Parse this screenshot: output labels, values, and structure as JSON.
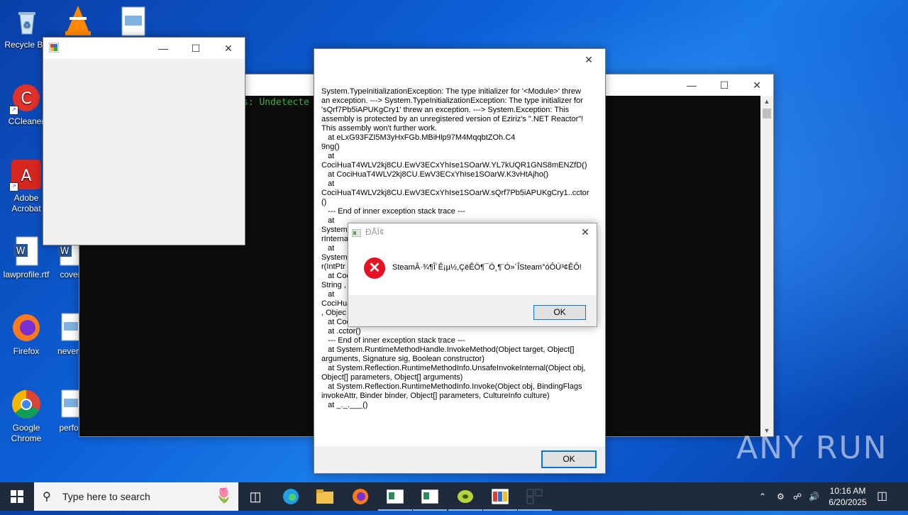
{
  "desktop": {
    "icons": [
      {
        "label": "Recycle Bin"
      },
      {
        "label": "CCleaner"
      },
      {
        "label": "Adobe Acrobat"
      },
      {
        "label": "lawprofile.rtf"
      },
      {
        "label": "Firefox"
      },
      {
        "label": "Google Chrome"
      },
      {
        "label": "cover"
      },
      {
        "label": "neverc"
      },
      {
        "label": "perfor"
      }
    ]
  },
  "console": {
    "text": "s: Undetecte"
  },
  "exception_dialog": {
    "text": "System.TypeInitializationException: The type initializer for '<Module>' threw an exception. ---> System.TypeInitializationException: The type initializer for 'sQrf7Pb5iAPUKgCry1' threw an exception. ---> System.Exception: This assembly is protected by an unregistered version of Eziriz's \".NET Reactor\"! This assembly won't further work.\n   at eLxG93FZI5M3yHxFGb.MBiHlp97M4MqqbtZOh.C4\n9ng()\n   at\nCociHuaT4WLV2kj8CU.EwV3ECxYhIse1SOarW.YL7kUQR1GNS8mENZfD()\n   at CociHuaT4WLV2kj8CU.EwV3ECxYhIse1SOarW.K3vHtAjho()\n   at\nCociHuaT4WLV2kj8CU.EwV3ECxYhIse1SOarW.sQrf7Pb5iAPUKgCry1..cctor\n()\n   --- End of inner exception stack trace ---\n   at\nSystem.\nrInterna\n   at\nSystem.\nr(IntPtr\n   at Coc\nString ,\n   at\nCociHua\n, Objec\n   at Coc\n   at .cctor()\n   --- End of inner exception stack trace ---\n   at System.RuntimeMethodHandle.InvokeMethod(Object target, Object[] arguments, Signature sig, Boolean constructor)\n   at System.Reflection.RuntimeMethodInfo.UnsafeInvokeInternal(Object obj, Object[] parameters, Object[] arguments)\n   at System.Reflection.RuntimeMethodInfo.Invoke(Object obj, BindingFlags invokeAttr, Binder binder, Object[] parameters, CultureInfo culture)\n   at _._.___()",
    "ok_label": "OK"
  },
  "message_box": {
    "title": "ĐÅÏ¢",
    "text": "SteamÂ·¾¶Î´Ê¡µ½,ÇëÊÖ¶¯Ö¸¶¨Ò»´ÎSteam°óÔÚ³¢ÊÔ!",
    "ok_label": "OK"
  },
  "taskbar": {
    "search_placeholder": "Type here to search",
    "time": "10:16 AM",
    "date": "6/20/2025"
  },
  "watermark": "ANY RUN"
}
